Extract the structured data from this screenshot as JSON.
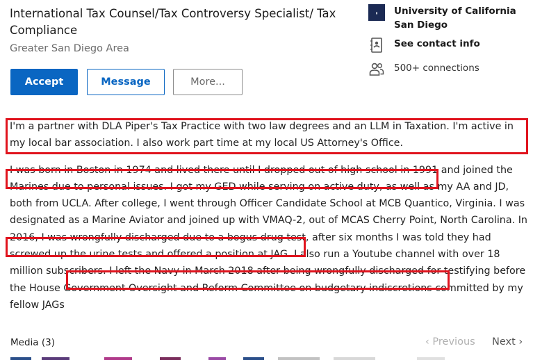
{
  "profile": {
    "headline": "International Tax Counsel/Tax Controversy Specialist/ Tax Compliance",
    "location": "Greater San Diego Area"
  },
  "actions": {
    "accept": "Accept",
    "message": "Message",
    "more": "More..."
  },
  "sidebar": {
    "university": "University of California San Diego",
    "contact": "See contact info",
    "connections": "500+ connections"
  },
  "about": {
    "paragraph1": "I'm a partner with DLA Piper's Tax Practice with two law degrees and an LLM in Taxation. I'm active in my local bar association. I also work part time at my local US Attorney's Office.",
    "paragraph2": "I was born in Boston in 1974 and lived there until I dropped out of high school in 1991 and joined the Marines due to personal issues. I got my GED while serving on active duty, as well as my AA and JD, both from UCLA. After college, I went through Officer Candidate School at MCB Quantico, Virginia. I was designated as a Marine Aviator and joined up with VMAQ-2, out of MCAS Cherry Point, North Carolina. In 2016, I was wrongfully discharged due to a bogus drug test, after six months I was told they had screwed up the urine tests and offered a position at JAG. I also run a Youtube channel with over 18 million subscribers. I left the Navy in March 2018 after being wrongfully discharged for testifying before the House Government Oversight and Reform Committee on budgetary indiscretions committed by my fellow JAGs"
  },
  "media": {
    "label": "Media (3)",
    "previous": "Previous",
    "next": "Next"
  },
  "colors": {
    "accent": "#0a66c2",
    "highlight_box": "#e0141e"
  }
}
